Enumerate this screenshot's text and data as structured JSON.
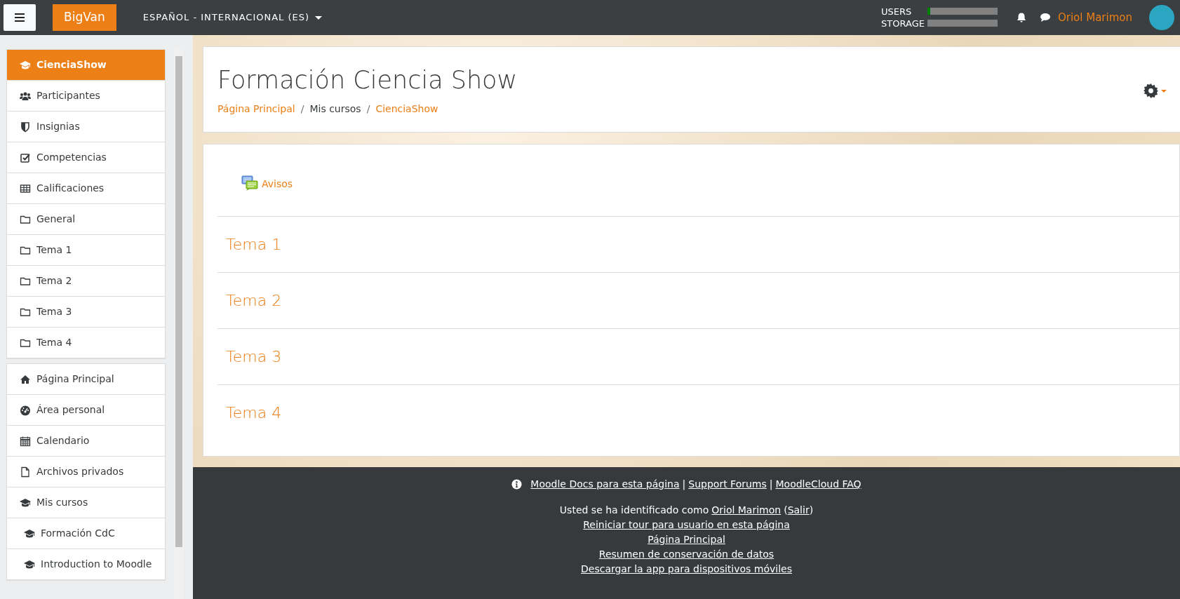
{
  "navbar": {
    "brand": "BigVan",
    "language": "ESPAÑOL - INTERNACIONAL (ES)",
    "quotas": [
      {
        "label": "USERS",
        "level": 0.04
      },
      {
        "label": "STORAGE"
      }
    ],
    "user_name": "Oriol Marimon"
  },
  "sidebar": {
    "groups": [
      [
        {
          "label": "CienciaShow",
          "kind": "course",
          "selected": true
        },
        {
          "label": "Participantes",
          "kind": "participants",
          "selected": false
        },
        {
          "label": "Insignias",
          "kind": "badges",
          "selected": false
        },
        {
          "label": "Competencias",
          "kind": "competencies",
          "selected": false
        },
        {
          "label": "Calificaciones",
          "kind": "grades",
          "selected": false
        },
        {
          "label": "General",
          "kind": "section",
          "selected": false
        },
        {
          "label": "Tema 1",
          "kind": "section",
          "selected": false
        },
        {
          "label": "Tema 2",
          "kind": "section",
          "selected": false
        },
        {
          "label": "Tema 3",
          "kind": "section",
          "selected": false
        },
        {
          "label": "Tema 4",
          "kind": "section",
          "selected": false
        }
      ],
      [
        {
          "label": "Página Principal",
          "kind": "home",
          "selected": false
        },
        {
          "label": "Área personal",
          "kind": "dashboard",
          "selected": false
        },
        {
          "label": "Calendario",
          "kind": "calendar",
          "selected": false
        },
        {
          "label": "Archivos privados",
          "kind": "files",
          "selected": false
        },
        {
          "label": "Mis cursos",
          "kind": "course",
          "selected": false
        },
        {
          "label": "Formación CdC",
          "kind": "subcourse",
          "selected": false
        },
        {
          "label": "Introduction to Moodle",
          "kind": "subcourse",
          "selected": false
        }
      ]
    ]
  },
  "page_header": {
    "title": "Formación Ciencia Show",
    "breadcrumb_separator": "/",
    "breadcrumb": [
      "Página Principal",
      "Mis cursos",
      "CienciaShow"
    ]
  },
  "course": {
    "activity": "Avisos",
    "sections": [
      "Tema 1",
      "Tema 2",
      "Tema 3",
      "Tema 4"
    ]
  },
  "footer": {
    "help_links": [
      "Moodle Docs para esta página",
      "Support Forums",
      "MoodleCloud FAQ"
    ],
    "separator": "|",
    "login_text": "Usted se ha identificado como",
    "login_user": "Oriol Marimon",
    "logout_open": "(",
    "logout": "Salir",
    "logout_close": ")",
    "links": [
      "Reiniciar tour para usuario en esta página",
      "Página Principal",
      "Resumen de conservación de datos",
      "Descargar la app para dispositivos móviles"
    ]
  }
}
